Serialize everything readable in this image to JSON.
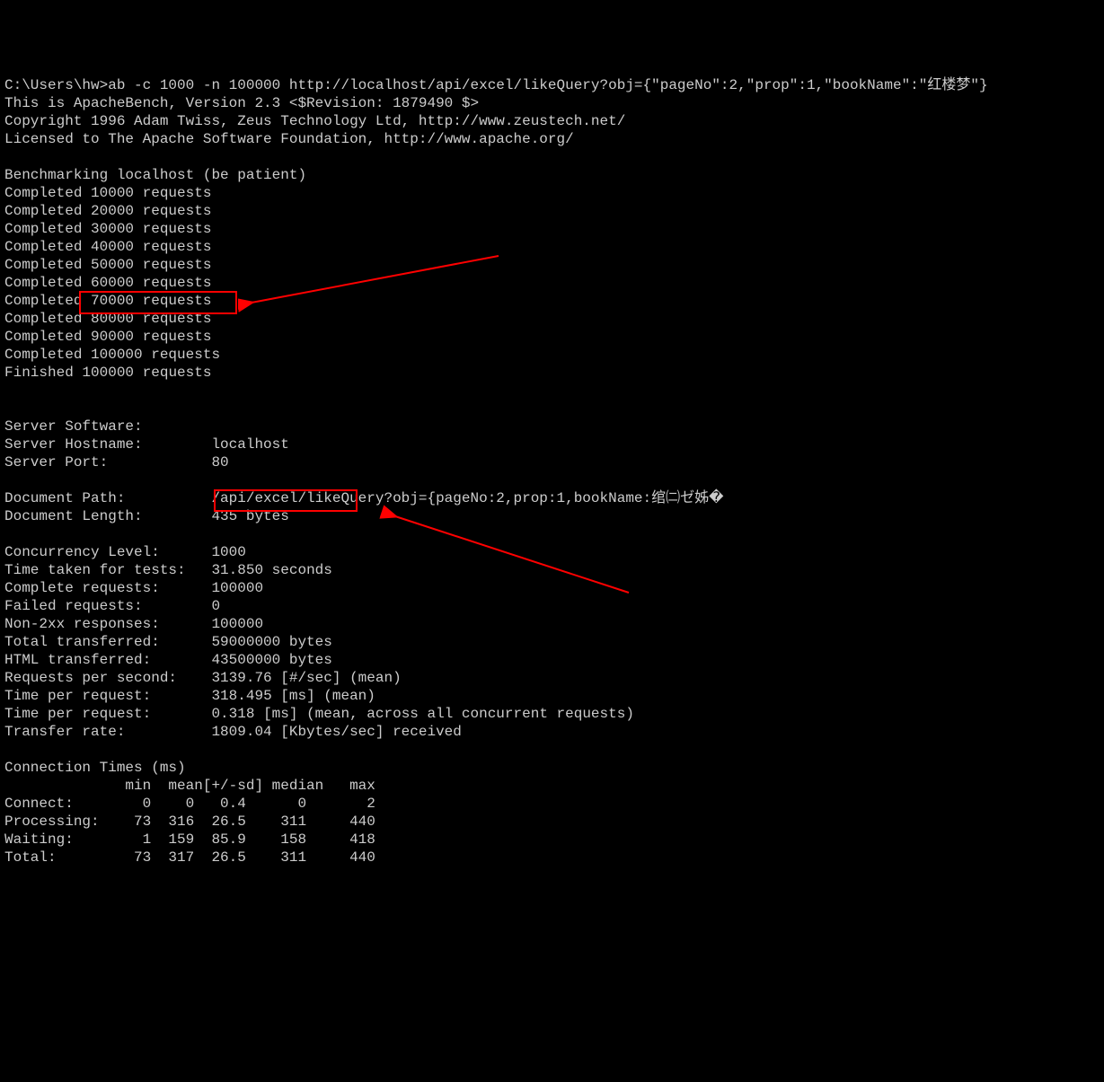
{
  "prompt": "C:\\Users\\hw>",
  "command": "ab -c 1000 -n 100000 http://localhost/api/excel/likeQuery?obj={\"pageNo\":2,\"prop\":1,\"bookName\":\"红楼梦\"}",
  "header": {
    "line1": "This is ApacheBench, Version 2.3 <$Revision: 1879490 $>",
    "line2": "Copyright 1996 Adam Twiss, Zeus Technology Ltd, http://www.zeustech.net/",
    "line3": "Licensed to The Apache Software Foundation, http://www.apache.org/"
  },
  "benchmark_header": "Benchmarking localhost (be patient)",
  "completed": [
    "Completed 10000 requests",
    "Completed 20000 requests",
    "Completed 30000 requests",
    "Completed 40000 requests",
    "Completed 50000 requests",
    "Completed 60000 requests",
    "Completed 70000 requests",
    "Completed 80000 requests",
    "Completed 90000 requests",
    "Completed 100000 requests"
  ],
  "finished_prefix": "Finished ",
  "finished_value": "100000 requests",
  "server": {
    "software_label": "Server Software:",
    "software_value": "",
    "hostname_label": "Server Hostname:",
    "hostname_value": "localhost",
    "port_label": "Server Port:",
    "port_value": "80"
  },
  "document": {
    "path_label": "Document Path:",
    "path_value": "/api/excel/likeQuery?obj={pageNo:2,prop:1,bookName:绾㈡ゼ姊�",
    "length_label": "Document Length:",
    "length_value": "435 bytes"
  },
  "stats": {
    "concurrency_label": "Concurrency Level:",
    "concurrency_value": "1000",
    "time_taken_label": "Time taken for tests:",
    "time_taken_value": "31.850 seconds",
    "complete_label": "Complete requests:",
    "complete_value": "100000",
    "failed_label": "Failed requests:",
    "failed_value": "0",
    "non2xx_label": "Non-2xx responses:",
    "non2xx_value": "100000",
    "total_transferred_label": "Total transferred:",
    "total_transferred_value": "59000000 bytes",
    "html_transferred_label": "HTML transferred:",
    "html_transferred_value": "43500000 bytes",
    "rps_label": "Requests per second:",
    "rps_value": "3139.76 [#/sec] (mean)",
    "tpr1_label": "Time per request:",
    "tpr1_value": "318.495 [ms] (mean)",
    "tpr2_label": "Time per request:",
    "tpr2_value": "0.318 [ms] (mean, across all concurrent requests)",
    "transfer_label": "Transfer rate:",
    "transfer_value": "1809.04 [Kbytes/sec] received"
  },
  "connection_times": {
    "title": "Connection Times (ms)",
    "header": "              min  mean[+/-sd] median   max",
    "connect": "Connect:        0    0   0.4      0       2",
    "processing": "Processing:    73  316  26.5    311     440",
    "waiting": "Waiting:        1  159  85.9    158     418",
    "total": "Total:         73  317  26.5    311     440"
  }
}
